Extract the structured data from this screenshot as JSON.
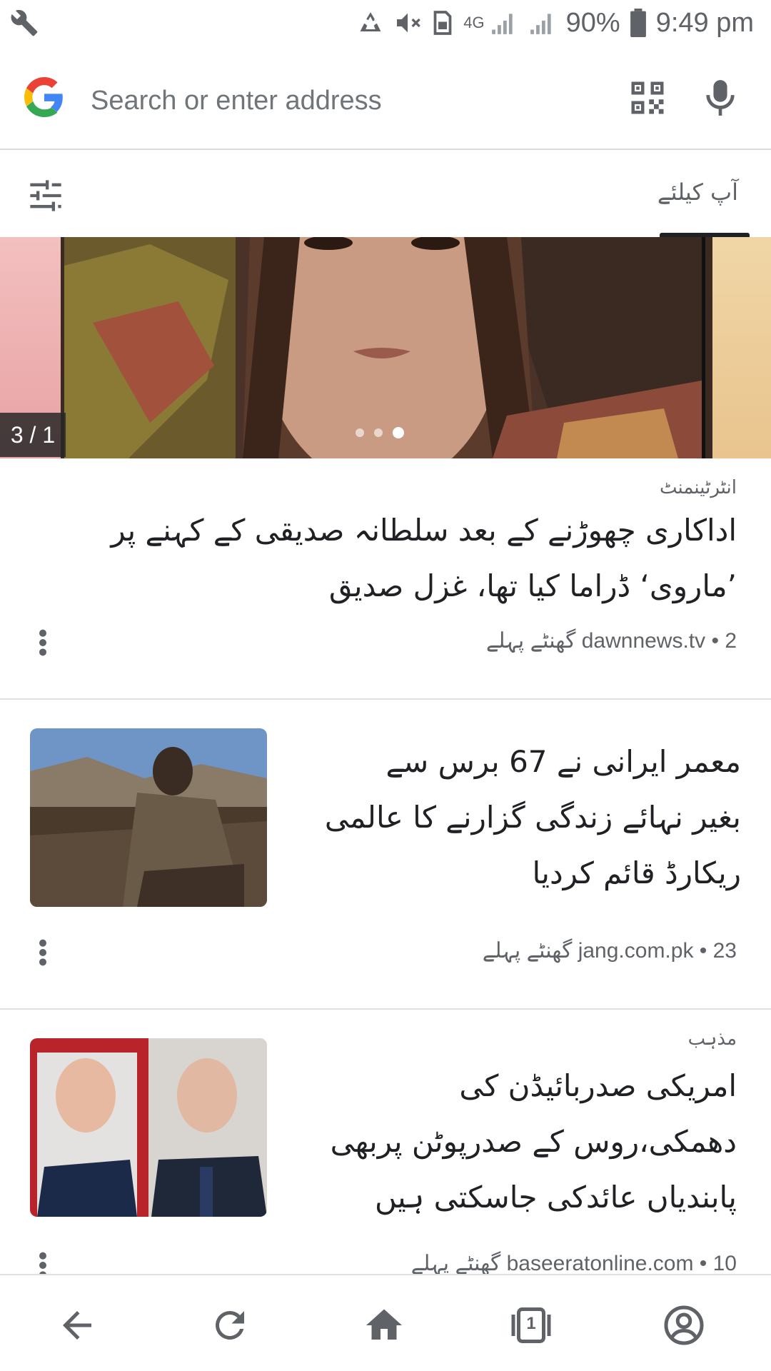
{
  "status_bar": {
    "battery": "90%",
    "time": "9:49 pm",
    "network": "4G"
  },
  "address_bar": {
    "placeholder": "Search or enter address",
    "icons": [
      "google-logo",
      "qr-code-icon",
      "mic-icon"
    ]
  },
  "feed": {
    "title": "آپ کیلئے",
    "settings_icon": "tune-icon"
  },
  "carousel": {
    "counter": "3 / 1",
    "dots": 3,
    "active_dot": 3
  },
  "articles": [
    {
      "category": "انٹرٹینمنٹ",
      "headline_line1": "اداکاری چھوڑنے کے بعد سلطانہ صدیقی کے کہنے پر",
      "headline_line2": "’ماروی‘ ڈراما کیا تھا، غزل صدیق",
      "meta": "dawnnews.tv • 2 گھنٹے پہلے"
    },
    {
      "category": "",
      "headline_line1": "معمر ایرانی نے 67 برس سے",
      "headline_line2": "بغیر نہائے زندگی گزارنے کا عالمی",
      "headline_line3": "ریکارڈ قائم کردیا",
      "meta": "jang.com.pk • 23 گھنٹے پہلے"
    },
    {
      "category": "مذہب",
      "headline_line1": "امریکی صدربائیڈن کی",
      "headline_line2": "دھمکی،روس کے صدرپوٹن پربھی",
      "headline_line3": "پابندیاں عائدکی جاسکتی ہیں",
      "meta": "baseeratonline.com • 10 گھنٹے پہلے"
    }
  ],
  "bottom_nav": {
    "tab_count": "1",
    "items": [
      "back-icon",
      "reload-icon",
      "home-icon",
      "tabs-icon",
      "account-icon"
    ]
  },
  "colors": {
    "text_primary": "#202124",
    "text_secondary": "#5f6368",
    "divider": "#e0e0e0"
  }
}
